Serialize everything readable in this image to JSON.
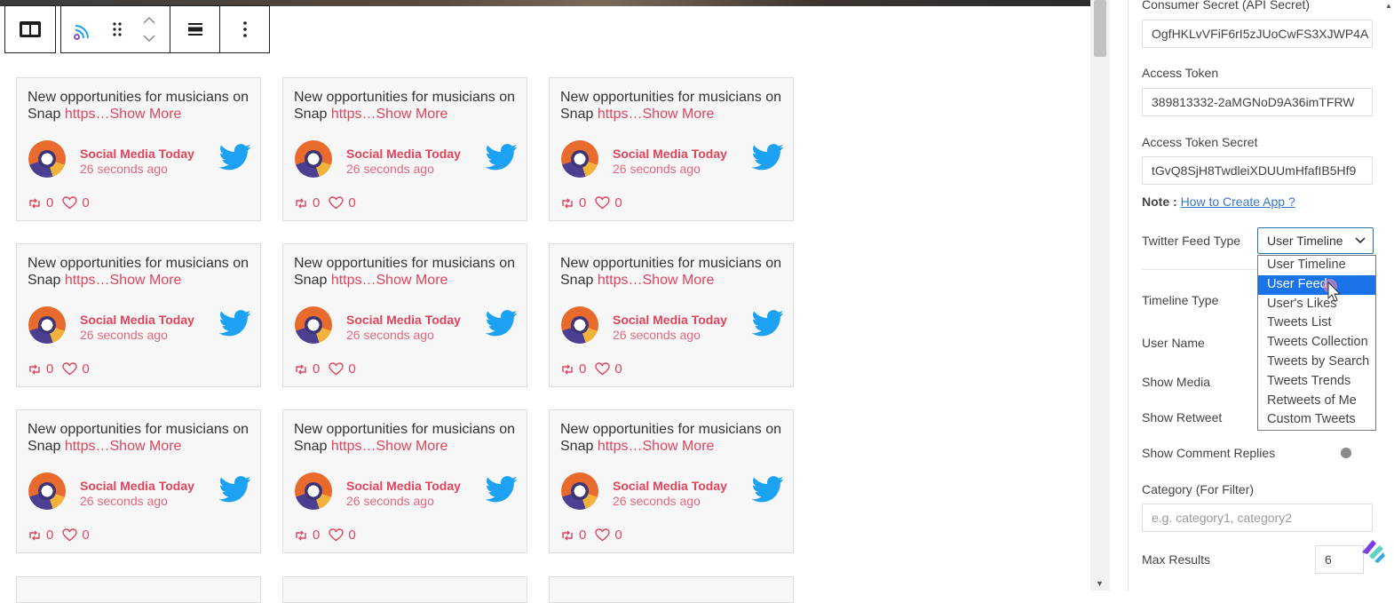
{
  "toolbar": {
    "items": [
      "block-layout-icon",
      "rss-feed-icon",
      "drag-handle-icon",
      "move-up-down-icon",
      "align-icon",
      "more-options-icon"
    ]
  },
  "cards": [
    {
      "text": "New opportunities for musicians on Snap ",
      "link": "https…",
      "more": "Show More",
      "author": "Social Media Today",
      "time": "26 seconds ago",
      "retweets": "0",
      "likes": "0"
    },
    {
      "text": "New opportunities for musicians on Snap ",
      "link": "https…",
      "more": "Show More",
      "author": "Social Media Today",
      "time": "26 seconds ago",
      "retweets": "0",
      "likes": "0"
    },
    {
      "text": "New opportunities for musicians on Snap ",
      "link": "https…",
      "more": "Show More",
      "author": "Social Media Today",
      "time": "26 seconds ago",
      "retweets": "0",
      "likes": "0"
    },
    {
      "text": "New opportunities for musicians on Snap ",
      "link": "https…",
      "more": "Show More",
      "author": "Social Media Today",
      "time": "26 seconds ago",
      "retweets": "0",
      "likes": "0"
    },
    {
      "text": "New opportunities for musicians on Snap ",
      "link": "https…",
      "more": "Show More",
      "author": "Social Media Today",
      "time": "26 seconds ago",
      "retweets": "0",
      "likes": "0"
    },
    {
      "text": "New opportunities for musicians on Snap ",
      "link": "https…",
      "more": "Show More",
      "author": "Social Media Today",
      "time": "26 seconds ago",
      "retweets": "0",
      "likes": "0"
    },
    {
      "text": "New opportunities for musicians on Snap ",
      "link": "https…",
      "more": "Show More",
      "author": "Social Media Today",
      "time": "26 seconds ago",
      "retweets": "0",
      "likes": "0"
    },
    {
      "text": "New opportunities for musicians on Snap ",
      "link": "https…",
      "more": "Show More",
      "author": "Social Media Today",
      "time": "26 seconds ago",
      "retweets": "0",
      "likes": "0"
    },
    {
      "text": "New opportunities for musicians on Snap ",
      "link": "https…",
      "more": "Show More",
      "author": "Social Media Today",
      "time": "26 seconds ago",
      "retweets": "0",
      "likes": "0"
    }
  ],
  "panel": {
    "consumer_secret_label": "Consumer Secret (API Secret)",
    "consumer_secret_value": "OgfHKLvVFiF6rI5zJUoCwFS3XJWP4A",
    "access_token_label": "Access Token",
    "access_token_value": "389813332-2aMGNoD9A36imTFRW",
    "access_token_secret_label": "Access Token Secret",
    "access_token_secret_value": "tGvQ8SjH8TwdleiXDUUmHfafIB5Hf9",
    "note_label": "Note :",
    "note_link": "How to Create App ?",
    "feed_type_label": "Twitter Feed Type",
    "feed_type_selected": "User Timeline",
    "feed_type_options": [
      "User Timeline",
      "User Feed",
      "User's Likes",
      "Tweets List",
      "Tweets Collection",
      "Tweets by Search",
      "Tweets Trends",
      "Retweets of Me",
      "Custom Tweets"
    ],
    "feed_type_highlighted": "User Feed",
    "timeline_type_label": "Timeline Type",
    "user_name_label": "User Name",
    "show_media_label": "Show Media",
    "show_retweet_label": "Show Retweet",
    "show_comment_replies_label": "Show Comment Replies",
    "show_comment_replies_on": false,
    "category_label": "Category (For Filter)",
    "category_placeholder": "e.g. category1, category2",
    "max_results_label": "Max Results",
    "max_results_value": "6"
  },
  "colors": {
    "accent": "#e0445b",
    "twitter": "#1da1f2",
    "select_highlight": "#1a73e8",
    "link": "#3b74c6"
  }
}
